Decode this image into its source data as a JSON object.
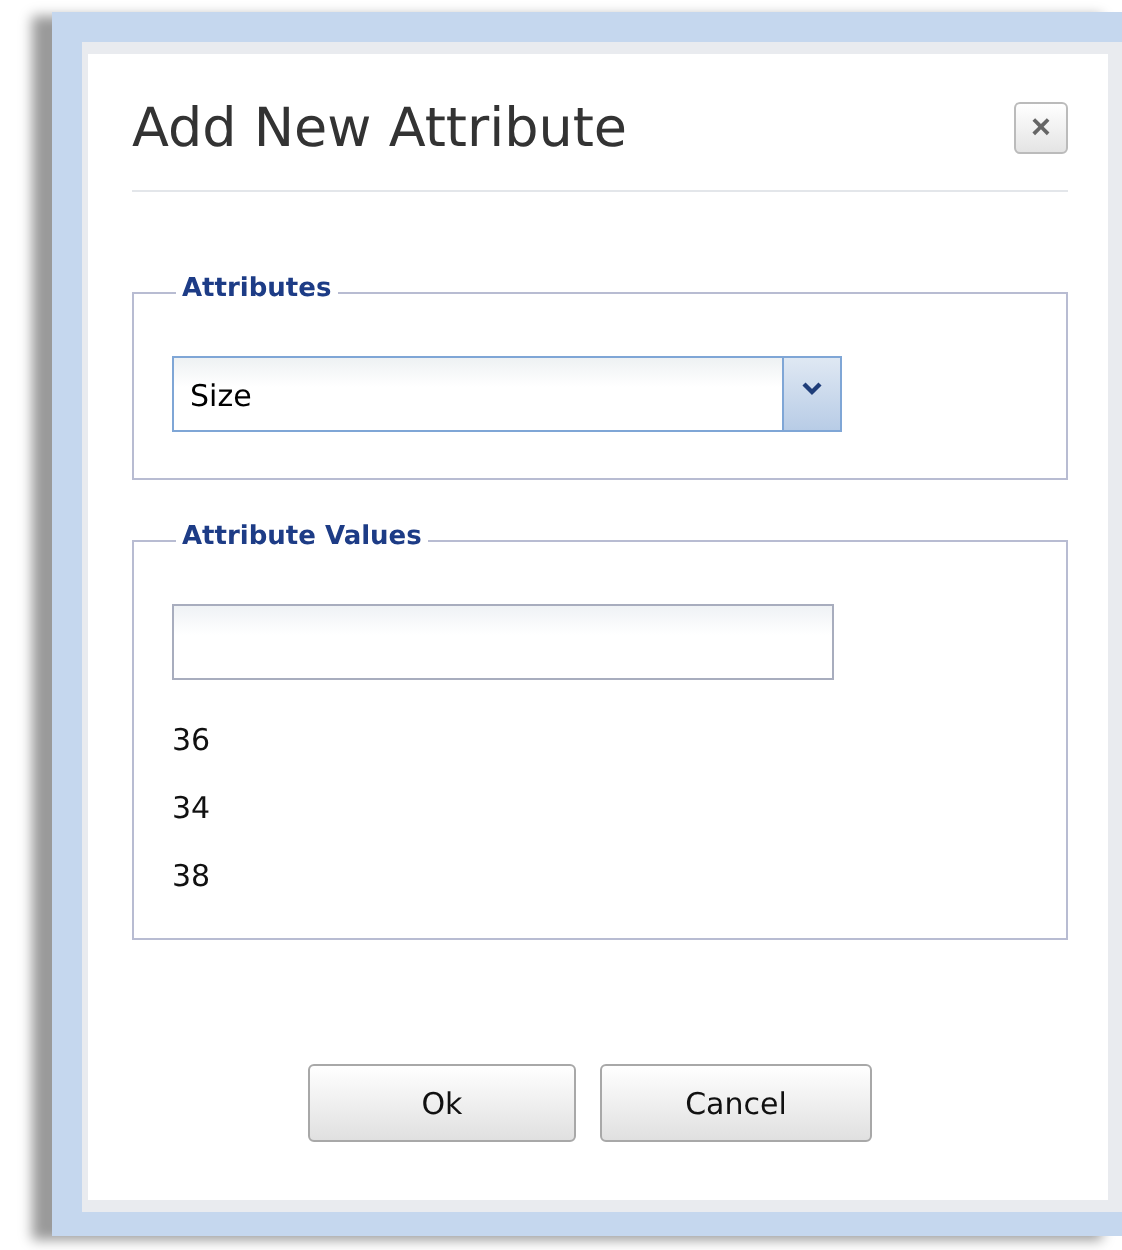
{
  "dialog": {
    "title": "Add New Attribute",
    "close": "×"
  },
  "attributes": {
    "legend": "Attributes",
    "select": {
      "value": "Size"
    }
  },
  "attribute_values": {
    "legend": "Attribute Values",
    "items": [
      "36",
      "34",
      "38"
    ]
  },
  "buttons": [
    "Ok",
    "Cancel"
  ]
}
